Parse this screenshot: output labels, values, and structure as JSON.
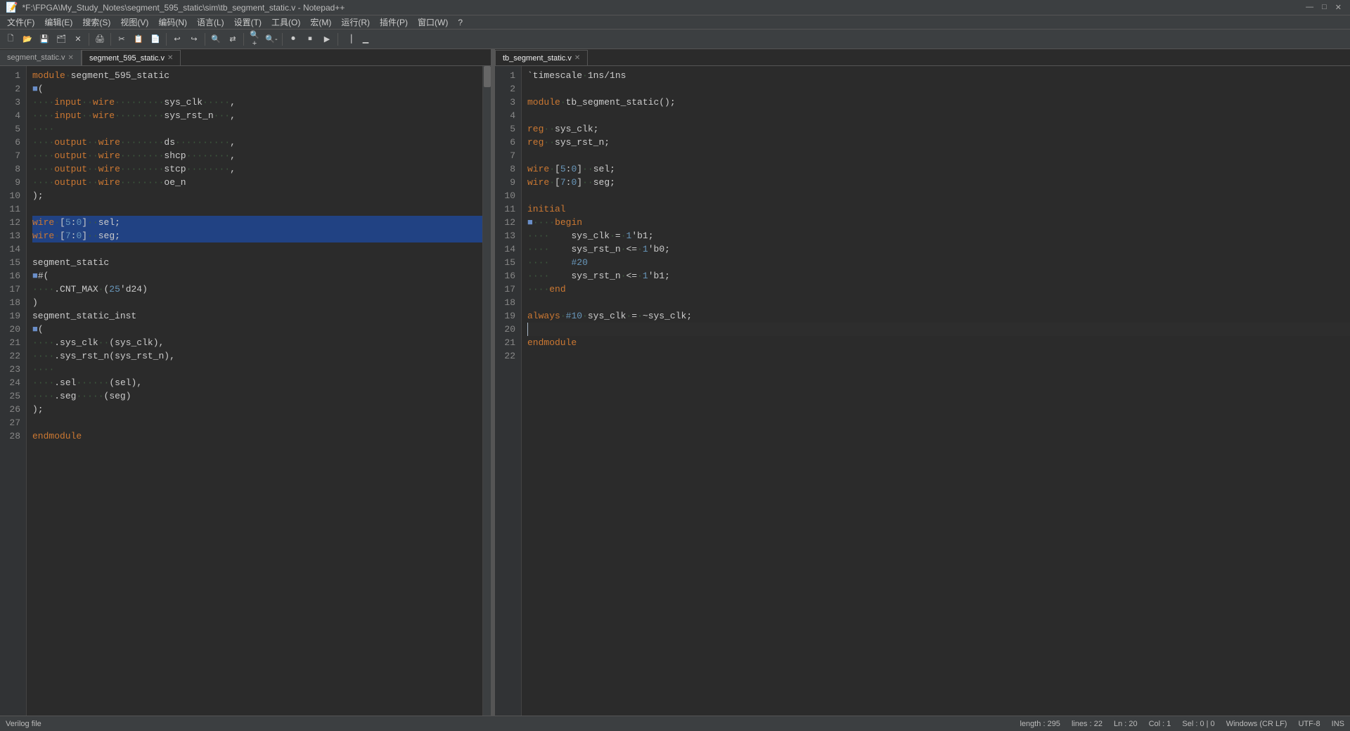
{
  "titlebar": {
    "text": "*F:\\FPGA\\My_Study_Notes\\segment_595_static\\sim\\tb_segment_static.v - Notepad++",
    "minimize": "—",
    "maximize": "□",
    "close": "✕"
  },
  "menubar": {
    "items": [
      "文件(F)",
      "编辑(E)",
      "搜索(S)",
      "视图(V)",
      "编码(N)",
      "语言(L)",
      "设置(T)",
      "工具(O)",
      "宏(M)",
      "运行(R)",
      "插件(P)",
      "窗口(W)",
      "?"
    ]
  },
  "pane_left": {
    "tabs": [
      {
        "label": "segment_static.v",
        "active": false,
        "closable": true
      },
      {
        "label": "segment_595_static.v",
        "active": true,
        "closable": true
      }
    ],
    "lines": [
      {
        "num": 1,
        "content": "module·segment_595_static",
        "type": "normal"
      },
      {
        "num": 2,
        "content": "■(",
        "type": "normal"
      },
      {
        "num": 3,
        "content": "····input··wire·········sys_clk·····,",
        "type": "normal"
      },
      {
        "num": 4,
        "content": "····input··wire·········sys_rst_n···,",
        "type": "normal"
      },
      {
        "num": 5,
        "content": "····",
        "type": "normal"
      },
      {
        "num": 6,
        "content": "····output··wire········ds··········,",
        "type": "normal"
      },
      {
        "num": 7,
        "content": "····output··wire········shcp········,",
        "type": "normal"
      },
      {
        "num": 8,
        "content": "····output··wire········stcp········,",
        "type": "normal"
      },
      {
        "num": 9,
        "content": "····output··wire········oe_n",
        "type": "normal"
      },
      {
        "num": 10,
        "content": ");",
        "type": "normal"
      },
      {
        "num": 11,
        "content": "",
        "type": "normal"
      },
      {
        "num": 12,
        "content": "wire·[5:0]··sel;",
        "type": "selected"
      },
      {
        "num": 13,
        "content": "wire·[7:0]··seg;",
        "type": "selected"
      },
      {
        "num": 14,
        "content": "",
        "type": "normal"
      },
      {
        "num": 15,
        "content": "segment_static",
        "type": "normal"
      },
      {
        "num": 16,
        "content": "■#(",
        "type": "normal"
      },
      {
        "num": 17,
        "content": "····.CNT_MAX·(25'd24)",
        "type": "normal"
      },
      {
        "num": 18,
        "content": ")",
        "type": "normal"
      },
      {
        "num": 19,
        "content": "segment_static_inst",
        "type": "normal"
      },
      {
        "num": 20,
        "content": "■(",
        "type": "normal"
      },
      {
        "num": 21,
        "content": "····.sys_clk··(sys_clk),",
        "type": "normal"
      },
      {
        "num": 22,
        "content": "····.sys_rst_n(sys_rst_n),",
        "type": "normal"
      },
      {
        "num": 23,
        "content": "····",
        "type": "normal"
      },
      {
        "num": 24,
        "content": "····.sel······(sel),",
        "type": "normal"
      },
      {
        "num": 25,
        "content": "····.seg·····(seg)",
        "type": "normal"
      },
      {
        "num": 26,
        "content": ");",
        "type": "normal"
      },
      {
        "num": 27,
        "content": "",
        "type": "normal"
      },
      {
        "num": 28,
        "content": "endmodule",
        "type": "normal"
      }
    ]
  },
  "pane_right": {
    "tabs": [
      {
        "label": "tb_segment_static.v",
        "active": true,
        "closable": true
      }
    ],
    "lines": [
      {
        "num": 1,
        "content": "`timescale·1ns/1ns"
      },
      {
        "num": 2,
        "content": ""
      },
      {
        "num": 3,
        "content": "module·tb_segment_static();"
      },
      {
        "num": 4,
        "content": ""
      },
      {
        "num": 5,
        "content": "reg··sys_clk;"
      },
      {
        "num": 6,
        "content": "reg··sys_rst_n;"
      },
      {
        "num": 7,
        "content": ""
      },
      {
        "num": 8,
        "content": "wire·[5:0]··sel;"
      },
      {
        "num": 9,
        "content": "wire·[7:0]··seg;"
      },
      {
        "num": 10,
        "content": ""
      },
      {
        "num": 11,
        "content": "initial"
      },
      {
        "num": 12,
        "content": "■····begin"
      },
      {
        "num": 13,
        "content": "····    sys_clk·=·1'b1;"
      },
      {
        "num": 14,
        "content": "····    sys_rst_n·<=·1'b0;"
      },
      {
        "num": 15,
        "content": "····    #20"
      },
      {
        "num": 16,
        "content": "····    sys_rst_n·<=·1'b1;"
      },
      {
        "num": 17,
        "content": "····end"
      },
      {
        "num": 18,
        "content": ""
      },
      {
        "num": 19,
        "content": "always·#10·sys_clk·=·~sys_clk;"
      },
      {
        "num": 20,
        "content": "",
        "cursor": true
      },
      {
        "num": 21,
        "content": "endmodule"
      },
      {
        "num": 22,
        "content": ""
      }
    ]
  },
  "statusbar": {
    "file_type": "Verilog file",
    "length": "length : 295",
    "lines": "lines : 22",
    "ln": "Ln : 20",
    "col": "Col : 1",
    "sel": "Sel : 0 | 0",
    "encoding": "Windows (CR LF)",
    "charset": "UTF-8",
    "insert": "INS"
  }
}
